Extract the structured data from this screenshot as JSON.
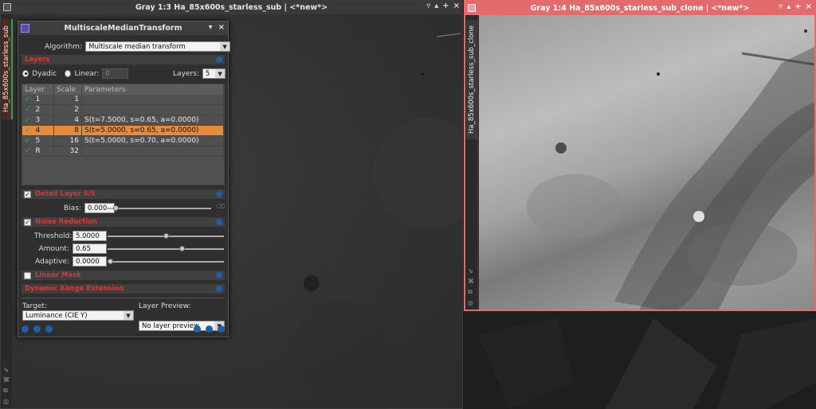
{
  "left_window": {
    "title": "Gray 1:3 Ha_85x600s_starless_sub | <*new*>",
    "side_tab": "Ha_85x600s_starless_sub",
    "buttons": [
      "▿",
      "▴",
      "+",
      "×"
    ],
    "side_icons": [
      "⇘",
      "⌘",
      "⧉",
      "◎"
    ]
  },
  "right_window": {
    "title": "Gray 1:4 Ha_85x600s_starless_sub_clone | <*new*>",
    "side_tab": "Ha_85x600s_starless_sub_clone",
    "buttons": [
      "▿",
      "▴",
      "+",
      "×"
    ],
    "side_icons": [
      "⇘",
      "⌘",
      "⧉",
      "◎"
    ]
  },
  "dialog": {
    "title": "MultiscaleMedianTransform",
    "title_buttons": [
      "▾",
      "×"
    ],
    "algorithm_label": "Algorithm:",
    "algorithm_value": "Multiscale median transform",
    "layers_section": "Layers",
    "dyadic_label": "Dyadic",
    "linear_label": "Linear:",
    "linear_value": "0",
    "layers_label": "Layers:",
    "layers_value": "5",
    "table": {
      "headers": [
        "Layer",
        "Scale",
        "Parameters"
      ],
      "rows": [
        {
          "layer": "1",
          "scale": "1",
          "params": "",
          "checked": true,
          "selected": false
        },
        {
          "layer": "2",
          "scale": "2",
          "params": "",
          "checked": true,
          "selected": false
        },
        {
          "layer": "3",
          "scale": "4",
          "params": "S(t=7.5000, s=0.65, a=0.0000)",
          "checked": true,
          "selected": false
        },
        {
          "layer": "4",
          "scale": "8",
          "params": "S(t=5.0000, s=0.65, a=0.0000)",
          "checked": true,
          "selected": true
        },
        {
          "layer": "5",
          "scale": "16",
          "params": "S(t=5.0000, s=0.70, a=0.0000)",
          "checked": true,
          "selected": false
        },
        {
          "layer": "R",
          "scale": "32",
          "params": "",
          "checked": true,
          "selected": false
        }
      ]
    },
    "detail_section": "Detail Layer 4/5",
    "bias_label": "Bias:",
    "bias_value": "0.000",
    "bias_level": 0.1,
    "noise_section": "Noise Reduction",
    "threshold_label": "Threshold:",
    "threshold_value": "5.0000",
    "threshold_level": 0.5,
    "amount_label": "Amount:",
    "amount_value": "0.65",
    "amount_level": 0.65,
    "adaptive_label": "Adaptive:",
    "adaptive_value": "0.0000",
    "adaptive_level": 0.0,
    "linear_mask_section": "Linear Mask",
    "dre_section": "Dynamic Range Extension",
    "target_label": "Target:",
    "target_value": "Luminance (CIE Y)",
    "layer_preview_label": "Layer Preview:",
    "layer_preview_value": "No layer preview"
  },
  "colors": {
    "accent_red": "#e36b6b",
    "section_red": "#d23a3a",
    "selection_orange": "#e58b3a",
    "check_green": "#2faa4c"
  }
}
